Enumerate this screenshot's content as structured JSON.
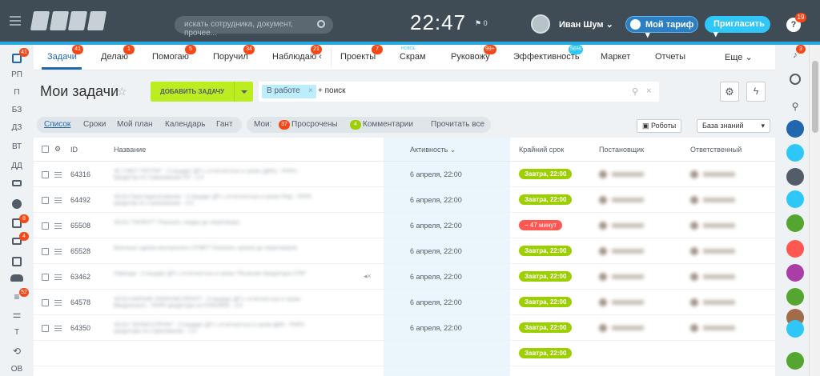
{
  "header": {
    "search_placeholder": "искать сотрудника, документ, прочее...",
    "clock": "22:47",
    "flag": "⚑ 0",
    "user": "Иван Шум",
    "tariff": "Мой тариф",
    "invite": "Пригласить",
    "help_badge": "19"
  },
  "leftbar": [
    {
      "label": "",
      "badge": "41"
    },
    {
      "label": "РП"
    },
    {
      "label": "П"
    },
    {
      "label": "БЗ"
    },
    {
      "label": "ДЗ"
    },
    {
      "label": "ВТ"
    },
    {
      "label": "ДД"
    },
    {
      "label": ""
    },
    {
      "label": ""
    },
    {
      "label": "",
      "badge": "8"
    },
    {
      "label": "",
      "badge": "4"
    },
    {
      "label": ""
    },
    {
      "label": ""
    },
    {
      "label": "",
      "badge": "52"
    },
    {
      "label": ""
    },
    {
      "label": "Т"
    },
    {
      "label": ""
    },
    {
      "label": "ОВ"
    }
  ],
  "rightbar": {
    "notif_badge": "3"
  },
  "tabs": [
    {
      "label": "Задачи",
      "badge": "41"
    },
    {
      "label": "Делаю",
      "badge": "1"
    },
    {
      "label": "Помогаю",
      "badge": "5"
    },
    {
      "label": "Поручил",
      "badge": "34"
    },
    {
      "label": "Наблюдаю",
      "badge": "21"
    },
    {
      "label": "Проекты",
      "badge": "7"
    },
    {
      "label": "Скрам",
      "new": "НОВОЕ"
    },
    {
      "label": "Руковожу",
      "badge": "99+"
    },
    {
      "label": "Эффективность",
      "badge": "56%"
    },
    {
      "label": "Маркет"
    },
    {
      "label": "Отчеты"
    },
    {
      "label": "Еще"
    }
  ],
  "page": {
    "title": "Мои задачи",
    "add_task": "ДОБАВИТЬ ЗАДАЧУ",
    "filter_chip": "В работе",
    "filter_search": "+ поиск"
  },
  "views": [
    "Список",
    "Сроки",
    "Мой план",
    "Календарь",
    "Гант"
  ],
  "mine": {
    "label": "Мои:",
    "overdue_count": "37",
    "overdue": "Просрочены",
    "comments_count": "4",
    "comments": "Комментарии",
    "read_all": "Прочитать все"
  },
  "buttons": {
    "robots": "Роботы",
    "kb": "База знаний"
  },
  "columns": {
    "id": "ID",
    "name": "Название",
    "activity": "Активность",
    "deadline": "Крайний срок",
    "creator": "Постановщик",
    "responsible": "Ответственный"
  },
  "rows": [
    {
      "id": "64316",
      "activity": "6 апреля, 22:00",
      "deadline": "Завтра, 22:00",
      "overdue": false,
      "text": "ЗС ГИБЛ \"ПОТЛЯ\" - Стандарт ДП с отчетностью в сроки (ДИК) - РНРК - Кредитор по страхованию ПУ - 2.0"
    },
    {
      "id": "64492",
      "activity": "6 апреля, 22:00",
      "deadline": "Завтра, 22:00",
      "overdue": false,
      "text": "ЗСОЗ Престарегатовиние - Стандарт ДП с отчетностью в сроки РКД - ПРРК кредитор по страхованию - 3.0"
    },
    {
      "id": "65508",
      "activity": "6 апреля, 22:00",
      "deadline": "− 47 минут",
      "overdue": true,
      "text": "ЗСОЗ \"ПИЛКУТ\" Показать скидку до переговора"
    },
    {
      "id": "65528",
      "activity": "6 апреля, 22:00",
      "deadline": "Завтра, 22:00",
      "overdue": false,
      "text": "Военные сделки внутреннего ОТВЕТ Показать сроков до переговоров"
    },
    {
      "id": "63462",
      "activity": "6 апреля, 22:00",
      "deadline": "Завтра, 22:00",
      "overdue": false,
      "text": "Ливенда - Стандарт ДП с отчетностью в сроки \"Решение Кредитора СПФ\"",
      "muted": true
    },
    {
      "id": "64578",
      "activity": "6 апреля, 22:00",
      "deadline": "Завтра, 22:00",
      "overdue": false,
      "text": "ЗСОЗ НАРКИЕ ИЛИКУМС/ПРИУТ - Стандарт ДП с отчетностью в сроки Введенского - РНРК кредитора по ПУБЛИКЕ - 2.0"
    },
    {
      "id": "64350",
      "activity": "6 апреля, 22:00",
      "deadline": "Завтра, 22:00",
      "overdue": false,
      "text": "ЗСОЗ \"ЗОЛИССПРИН\" - Стандарт ДП с отчетностью в сроки ДИК - РНРК кредитора по страхованию - 2.0"
    },
    {
      "id": "",
      "activity": "",
      "deadline": "Завтра, 22:00",
      "overdue": false,
      "text": ""
    }
  ]
}
